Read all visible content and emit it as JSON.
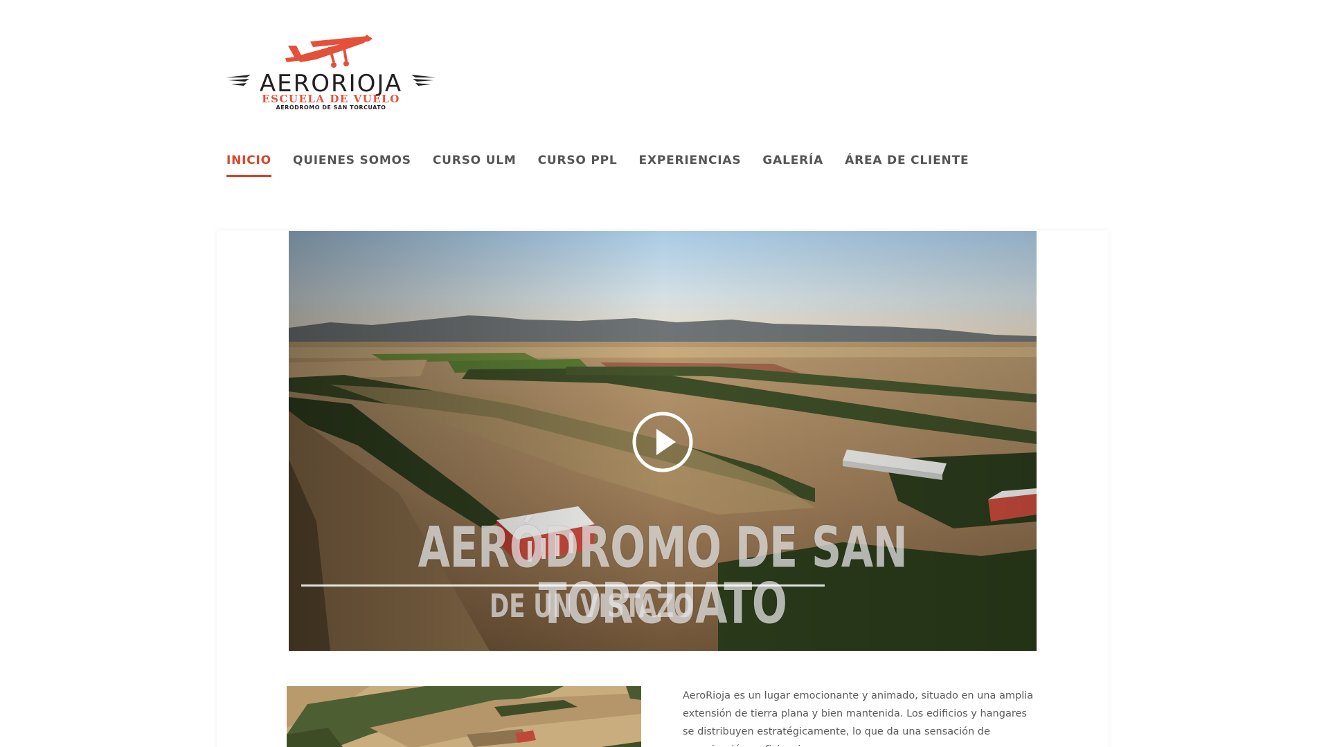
{
  "logo": {
    "brand": "AERORIOJA",
    "tagline": "ESCUELA DE VUELO",
    "subtag": "AERÓDROMO DE SAN TORCUATO",
    "icon": "airplane-icon",
    "brand_color": "#231f20",
    "accent_color": "#e5503a"
  },
  "nav": {
    "items": [
      {
        "label": "INICIO",
        "active": true
      },
      {
        "label": "QUIENES SOMOS",
        "active": false
      },
      {
        "label": "CURSO ULM",
        "active": false
      },
      {
        "label": "CURSO PPL",
        "active": false
      },
      {
        "label": "EXPERIENCIAS",
        "active": false
      },
      {
        "label": "GALERÍA",
        "active": false
      },
      {
        "label": "ÁREA DE CLIENTE",
        "active": false
      }
    ],
    "active_color": "#d9442b",
    "text_color": "#555555"
  },
  "video": {
    "overlay_title": "AERÓDROMO DE SAN TORCUATO",
    "overlay_subtitle": "DE UN VISTAZO",
    "play_icon": "play-icon"
  },
  "intro": {
    "text": "AeroRioja es un lugar emocionante y animado, situado en una amplia extensión de tierra plana y bien mantenida. Los edificios y hangares se distribuyen estratégicamente, lo que da una sensación de organización y eficiencia."
  }
}
